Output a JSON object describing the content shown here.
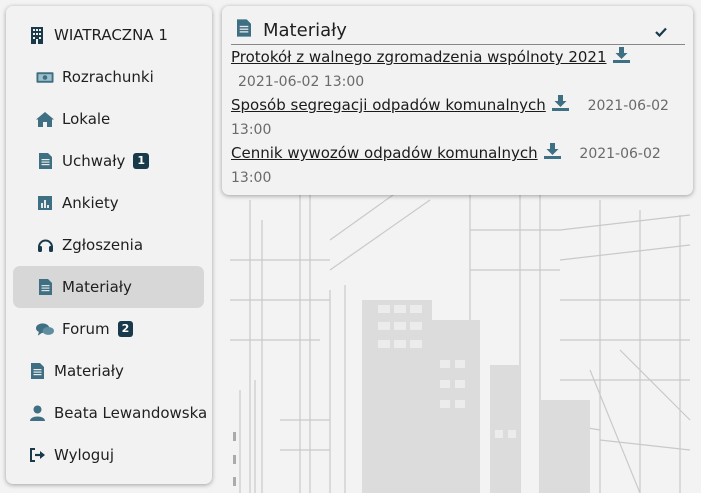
{
  "sidebar": {
    "building": "WIATRACZNA 1",
    "items": [
      {
        "label": "Rozrachunki"
      },
      {
        "label": "Lokale"
      },
      {
        "label": "Uchwały",
        "badge": "1"
      },
      {
        "label": "Ankiety"
      },
      {
        "label": "Zgłoszenia"
      },
      {
        "label": "Materiały"
      },
      {
        "label": "Forum",
        "badge": "2"
      }
    ],
    "materials": "Materiały",
    "user": "Beata Lewandowska",
    "logout": "Wyloguj"
  },
  "card": {
    "title": "Materiały",
    "docs": [
      {
        "name": "Protokół z walnego zgromadzenia wspólnoty 2021",
        "date": "2021-06-02 13:00"
      },
      {
        "name": "Sposób segregacji odpadów komunalnych",
        "date_part1": "2021-06-02",
        "date_part2": "13:00"
      },
      {
        "name": "Cennik wywozów odpadów komunalnych",
        "date_part1": "2021-06-02",
        "date_part2": "13:00"
      }
    ]
  },
  "colors": {
    "accent": "#183a4a",
    "icon": "#3f6f82",
    "active_bg": "#d7d7d7"
  }
}
